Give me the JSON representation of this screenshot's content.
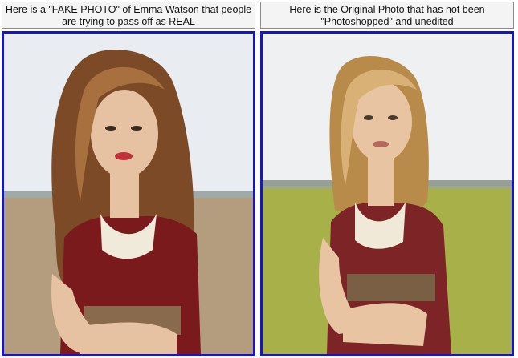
{
  "panels": [
    {
      "caption": "Here is a \"FAKE PHOTO\" of Emma Watson that people are trying to pass off as REAL",
      "photo": {
        "sky": "#e9edf2",
        "field": "#b49c7e",
        "hair": "#7c4a27",
        "hair_highlight": "#a8703f",
        "dress": "#7a1a1c",
        "skin": "#e6c2a3",
        "lace": "#f0eadb",
        "belt": "#8a6a4c"
      }
    },
    {
      "caption": "Here is the Original Photo that has not been \"Photoshopped\" and unedited",
      "photo": {
        "sky": "#eef0f2",
        "field": "#a8b04a",
        "hair": "#b98b4a",
        "hair_highlight": "#d9b176",
        "dress": "#7d2426",
        "skin": "#e9c4a2",
        "lace": "#f0e9d8",
        "belt": "#7b5f44"
      }
    }
  ],
  "frame_color": "#1616c8"
}
